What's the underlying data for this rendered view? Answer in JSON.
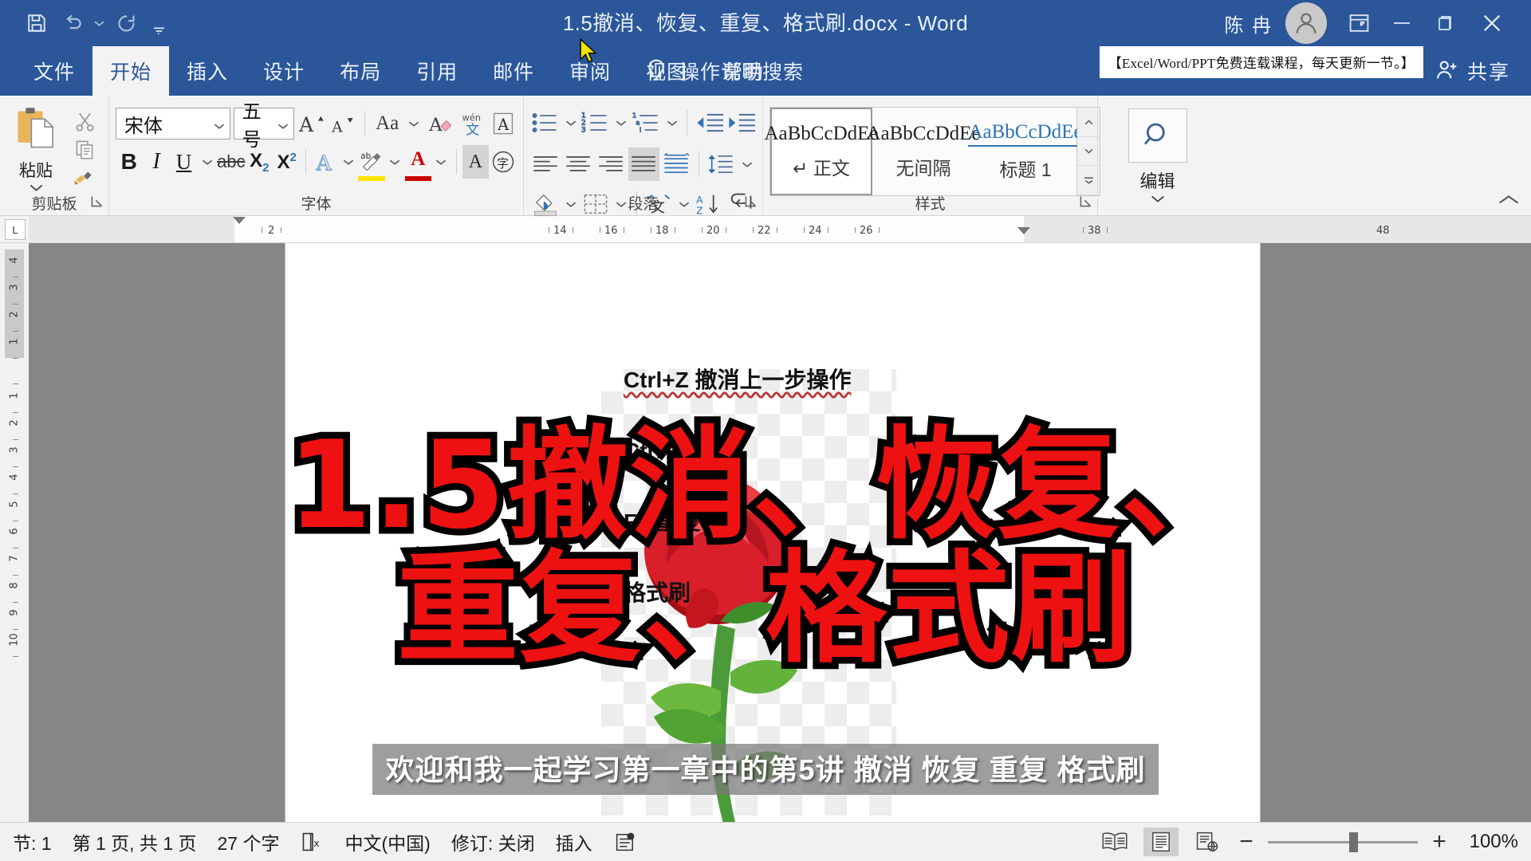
{
  "titlebar": {
    "document_title": "1.5撤消、恢复、重复、格式刷.docx  -  Word",
    "username": "陈 冉",
    "quick_access": [
      {
        "name": "save",
        "icon": "save-icon"
      },
      {
        "name": "undo",
        "icon": "undo-icon"
      },
      {
        "name": "redo",
        "icon": "redo-icon"
      },
      {
        "name": "customize",
        "icon": "caret-down-icon"
      }
    ],
    "window_buttons": [
      "ribbon-display-options",
      "minimize",
      "restore",
      "close"
    ]
  },
  "promo_banner": "【Excel/Word/PPT免费连载课程，每天更新一节。】",
  "tabs": [
    {
      "label": "文件",
      "active": false
    },
    {
      "label": "开始",
      "active": true
    },
    {
      "label": "插入",
      "active": false
    },
    {
      "label": "设计",
      "active": false
    },
    {
      "label": "布局",
      "active": false
    },
    {
      "label": "引用",
      "active": false
    },
    {
      "label": "邮件",
      "active": false
    },
    {
      "label": "审阅",
      "active": false
    },
    {
      "label": "视图",
      "active": false
    },
    {
      "label": "帮助",
      "active": false
    }
  ],
  "tell_me": "操作说明搜索",
  "share": "共享",
  "ribbon": {
    "clipboard": {
      "group_label": "剪贴板",
      "paste_label": "粘贴",
      "cut": "剪切",
      "copy": "复制",
      "format_painter": "格式刷"
    },
    "font": {
      "group_label": "字体",
      "font_name": "宋体",
      "font_size": "五号",
      "buttons": [
        "增大字号",
        "减小字号",
        "更改大小写",
        "清除所有格式",
        "拼音指南",
        "字符边框",
        "加粗",
        "倾斜",
        "下划线",
        "删除线",
        "下标",
        "上标",
        "文本效果和版式",
        "以不同颜色突出显示文本",
        "字体颜色",
        "字符底纹",
        "带圈字符"
      ],
      "bold": "B",
      "italic": "I",
      "underline": "U",
      "strikethrough": "abc",
      "subscript": "X₂",
      "superscript": "X²"
    },
    "paragraph": {
      "group_label": "段落",
      "buttons": [
        "项目符号",
        "编号",
        "多级列表",
        "减少缩进量",
        "增加缩进量",
        "左对齐",
        "居中",
        "右对齐",
        "两端对齐",
        "分散对齐",
        "行和段落间距",
        "底纹",
        "边框",
        "中文版式",
        "排序",
        "显示/隐藏编辑标记"
      ]
    },
    "styles": {
      "group_label": "样式",
      "items": [
        {
          "sample": "AaBbCcDdEe",
          "name": "↵ 正文",
          "selected": true
        },
        {
          "sample": "AaBbCcDdEe",
          "name": "无间隔",
          "selected": false
        },
        {
          "sample": "AaBbCcDdEe",
          "name": "标题 1",
          "selected": false
        }
      ]
    },
    "editing": {
      "group_label": "",
      "label": "编辑",
      "icon": "search-icon"
    }
  },
  "ruler": {
    "tab_stop": "L",
    "h_ticks": [
      "2",
      "14",
      "16",
      "18",
      "20",
      "22",
      "24",
      "26",
      "38",
      "48"
    ],
    "v_ticks_margin": [
      "4",
      "3",
      "2",
      "1"
    ],
    "v_ticks_body": [
      "1",
      "2",
      "3",
      "4",
      "5",
      "6",
      "7",
      "8",
      "9",
      "10"
    ]
  },
  "document": {
    "lines": [
      "Ctrl+Z 撤消上一步操作",
      "Ctrl+Y 恢复",
      "F4 重复",
      "格式刷"
    ]
  },
  "overlay": {
    "line1": "1.5撤消、恢复、",
    "line2": "重复、格式刷",
    "color": "#ee1111",
    "stroke": "#000000"
  },
  "caption": "欢迎和我一起学习第一章中的第5讲 撤消 恢复 重复 格式刷",
  "statusbar": {
    "section": "节: 1",
    "page": "第 1 页, 共 1 页",
    "words": "27 个字",
    "proofing_icon": "spelling-check-icon",
    "language": "中文(中国)",
    "track_changes": "修订: 关闭",
    "insert_mode": "插入",
    "macro_icon": "macro-record-icon",
    "views": [
      {
        "name": "read-mode",
        "active": false
      },
      {
        "name": "print-layout",
        "active": true
      },
      {
        "name": "web-layout",
        "active": false
      }
    ],
    "zoom_out": "−",
    "zoom_in": "+",
    "zoom_level": "100%"
  },
  "colors": {
    "brand_blue": "#2b579a",
    "ribbon_bg": "#f3f3f3",
    "accent_icon": "#2e74b5",
    "canvas_gray": "#868686"
  }
}
